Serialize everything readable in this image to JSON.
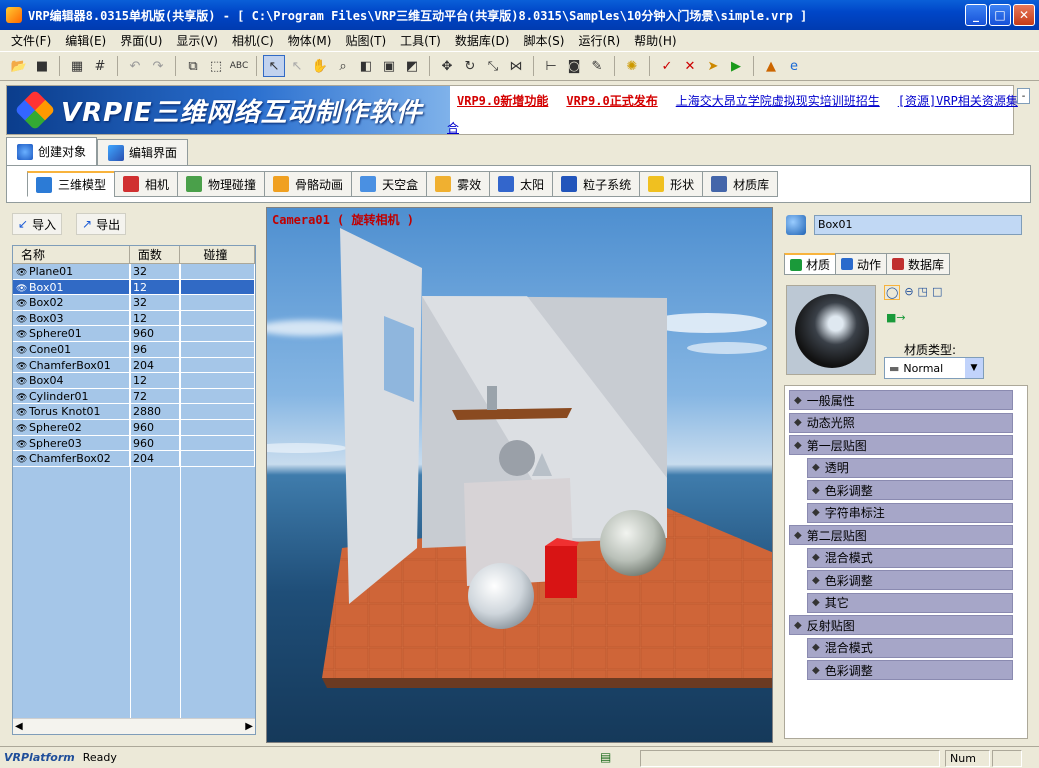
{
  "window": {
    "title": "VRP编辑器8.0315单机版(共享版) - [ C:\\Program Files\\VRP三维互动平台(共享版)8.0315\\Samples\\10分钟入门场景\\simple.vrp ]",
    "minimize": "_",
    "maximize": "□",
    "close": "✕"
  },
  "menu": [
    "文件(F)",
    "编辑(E)",
    "界面(U)",
    "显示(V)",
    "相机(C)",
    "物体(M)",
    "贴图(T)",
    "工具(T)",
    "数据库(D)",
    "脚本(S)",
    "运行(R)",
    "帮助(H)"
  ],
  "toolbar": {
    "icons": [
      "open-icon",
      "save-icon",
      "sep",
      "grid-icon",
      "hash-icon",
      "sep",
      "undo-icon",
      "redo-icon",
      "sep",
      "copy-icon",
      "select-rect-icon",
      "text-icon",
      "sep",
      "pointer-icon",
      "pointer2-icon",
      "hand-icon",
      "zoom-icon",
      "fit-icon",
      "frame-icon",
      "cube-icon",
      "sep",
      "move-icon",
      "rotate-icon",
      "scale-icon",
      "mirror-icon",
      "sep",
      "align-icon",
      "camera-icon",
      "paint-icon",
      "sep",
      "render-icon",
      "sep",
      "check-icon",
      "cross-icon",
      "export-icon",
      "play-icon",
      "sep",
      "brush-icon",
      "browser-icon"
    ]
  },
  "banner": {
    "logo_text": "VRPIE三维网络互动制作软件",
    "links": [
      {
        "text": "VRP9.0新增功能",
        "style": "red"
      },
      {
        "text": "VRP9.0正式发布",
        "style": "red"
      },
      {
        "text": "上海交大昂立学院虚拟现实培训班招生",
        "style": "blue"
      },
      {
        "text": "[资源]VRP相关资源集",
        "style": "blue"
      }
    ],
    "overflow_text": "合",
    "collapse": "-"
  },
  "main_tabs": [
    {
      "label": "创建对象",
      "icon": "create-icon",
      "active": true
    },
    {
      "label": "编辑界面",
      "icon": "edit-ui-icon",
      "active": false
    }
  ],
  "sub_tabs": [
    {
      "label": "三维模型",
      "icon": "model-icon",
      "active": true,
      "color": "#2c7bd6"
    },
    {
      "label": "相机",
      "icon": "camera-icon",
      "color": "#d03030"
    },
    {
      "label": "物理碰撞",
      "icon": "physics-icon",
      "color": "#4aa04a"
    },
    {
      "label": "骨骼动画",
      "icon": "skeleton-icon",
      "color": "#f0a020"
    },
    {
      "label": "天空盒",
      "icon": "skybox-icon",
      "color": "#4a90e2"
    },
    {
      "label": "雾效",
      "icon": "fog-icon",
      "color": "#f0b030"
    },
    {
      "label": "太阳",
      "icon": "sun-icon",
      "color": "#3366cc"
    },
    {
      "label": "粒子系统",
      "icon": "particle-icon",
      "color": "#2255bb"
    },
    {
      "label": "形状",
      "icon": "shape-icon",
      "color": "#f0c020"
    },
    {
      "label": "材质库",
      "icon": "material-lib-icon",
      "color": "#4466aa"
    }
  ],
  "left": {
    "import_label": "导入",
    "export_label": "导出",
    "columns": [
      "名称",
      "面数",
      "碰撞"
    ],
    "rows": [
      {
        "name": "Plane01",
        "faces": "32"
      },
      {
        "name": "Box01",
        "faces": "12",
        "selected": true
      },
      {
        "name": "Box02",
        "faces": "32"
      },
      {
        "name": "Box03",
        "faces": "12"
      },
      {
        "name": "Sphere01",
        "faces": "960"
      },
      {
        "name": "Cone01",
        "faces": "96"
      },
      {
        "name": "ChamferBox01",
        "faces": "204"
      },
      {
        "name": "Box04",
        "faces": "12"
      },
      {
        "name": "Cylinder01",
        "faces": "72"
      },
      {
        "name": "Torus Knot01",
        "faces": "2880"
      },
      {
        "name": "Sphere02",
        "faces": "960"
      },
      {
        "name": "Sphere03",
        "faces": "960"
      },
      {
        "name": "ChamferBox02",
        "faces": "204"
      }
    ]
  },
  "viewport": {
    "camera_label": "Camera01 ( 旋转相机 )"
  },
  "right": {
    "object_name": "Box01",
    "tabs": [
      {
        "label": "材质",
        "active": true
      },
      {
        "label": "动作"
      },
      {
        "label": "数据库"
      }
    ],
    "material_type_label": "材质类型:",
    "material_type_value": "Normal",
    "properties": [
      {
        "label": "一般属性",
        "level": 0,
        "icon": "general-icon"
      },
      {
        "label": "动态光照",
        "level": 0,
        "icon": "light-icon"
      },
      {
        "label": "第一层贴图",
        "level": 0,
        "icon": "texture-icon"
      },
      {
        "label": "透明",
        "level": 1,
        "icon": "transparent-icon"
      },
      {
        "label": "色彩调整",
        "level": 1,
        "icon": "color-icon"
      },
      {
        "label": "字符串标注",
        "level": 1,
        "icon": "string-icon"
      },
      {
        "label": "第二层贴图",
        "level": 0,
        "icon": "texture-icon"
      },
      {
        "label": "混合模式",
        "level": 1,
        "icon": "blend-icon"
      },
      {
        "label": "色彩调整",
        "level": 1,
        "icon": "color-icon"
      },
      {
        "label": "其它",
        "level": 1,
        "icon": "other-icon"
      },
      {
        "label": "反射贴图",
        "level": 0,
        "icon": "reflect-icon"
      },
      {
        "label": "混合模式",
        "level": 1,
        "icon": "blend-icon"
      },
      {
        "label": "色彩调整",
        "level": 1,
        "icon": "color-icon"
      }
    ]
  },
  "status": {
    "brand": "VRPlatform",
    "text": "Ready",
    "num": "Num"
  }
}
